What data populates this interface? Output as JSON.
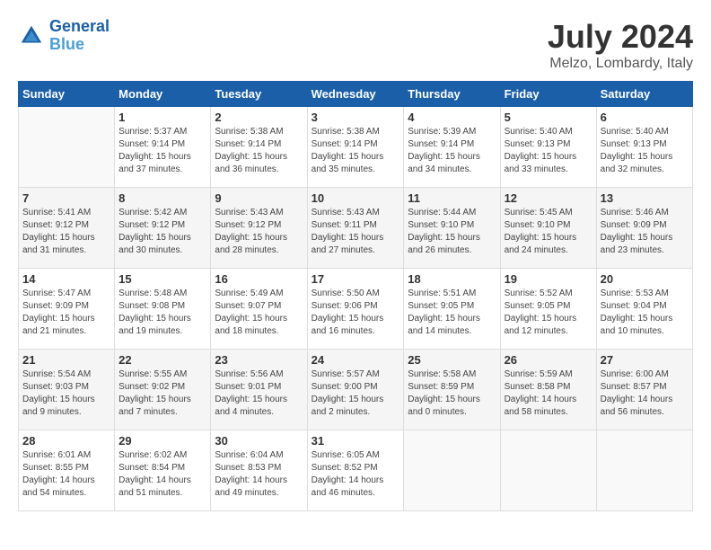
{
  "header": {
    "logo_line1": "General",
    "logo_line2": "Blue",
    "month_year": "July 2024",
    "location": "Melzo, Lombardy, Italy"
  },
  "weekdays": [
    "Sunday",
    "Monday",
    "Tuesday",
    "Wednesday",
    "Thursday",
    "Friday",
    "Saturday"
  ],
  "weeks": [
    [
      {
        "day": "",
        "sunrise": "",
        "sunset": "",
        "daylight": ""
      },
      {
        "day": "1",
        "sunrise": "Sunrise: 5:37 AM",
        "sunset": "Sunset: 9:14 PM",
        "daylight": "Daylight: 15 hours and 37 minutes."
      },
      {
        "day": "2",
        "sunrise": "Sunrise: 5:38 AM",
        "sunset": "Sunset: 9:14 PM",
        "daylight": "Daylight: 15 hours and 36 minutes."
      },
      {
        "day": "3",
        "sunrise": "Sunrise: 5:38 AM",
        "sunset": "Sunset: 9:14 PM",
        "daylight": "Daylight: 15 hours and 35 minutes."
      },
      {
        "day": "4",
        "sunrise": "Sunrise: 5:39 AM",
        "sunset": "Sunset: 9:14 PM",
        "daylight": "Daylight: 15 hours and 34 minutes."
      },
      {
        "day": "5",
        "sunrise": "Sunrise: 5:40 AM",
        "sunset": "Sunset: 9:13 PM",
        "daylight": "Daylight: 15 hours and 33 minutes."
      },
      {
        "day": "6",
        "sunrise": "Sunrise: 5:40 AM",
        "sunset": "Sunset: 9:13 PM",
        "daylight": "Daylight: 15 hours and 32 minutes."
      }
    ],
    [
      {
        "day": "7",
        "sunrise": "Sunrise: 5:41 AM",
        "sunset": "Sunset: 9:12 PM",
        "daylight": "Daylight: 15 hours and 31 minutes."
      },
      {
        "day": "8",
        "sunrise": "Sunrise: 5:42 AM",
        "sunset": "Sunset: 9:12 PM",
        "daylight": "Daylight: 15 hours and 30 minutes."
      },
      {
        "day": "9",
        "sunrise": "Sunrise: 5:43 AM",
        "sunset": "Sunset: 9:12 PM",
        "daylight": "Daylight: 15 hours and 28 minutes."
      },
      {
        "day": "10",
        "sunrise": "Sunrise: 5:43 AM",
        "sunset": "Sunset: 9:11 PM",
        "daylight": "Daylight: 15 hours and 27 minutes."
      },
      {
        "day": "11",
        "sunrise": "Sunrise: 5:44 AM",
        "sunset": "Sunset: 9:10 PM",
        "daylight": "Daylight: 15 hours and 26 minutes."
      },
      {
        "day": "12",
        "sunrise": "Sunrise: 5:45 AM",
        "sunset": "Sunset: 9:10 PM",
        "daylight": "Daylight: 15 hours and 24 minutes."
      },
      {
        "day": "13",
        "sunrise": "Sunrise: 5:46 AM",
        "sunset": "Sunset: 9:09 PM",
        "daylight": "Daylight: 15 hours and 23 minutes."
      }
    ],
    [
      {
        "day": "14",
        "sunrise": "Sunrise: 5:47 AM",
        "sunset": "Sunset: 9:09 PM",
        "daylight": "Daylight: 15 hours and 21 minutes."
      },
      {
        "day": "15",
        "sunrise": "Sunrise: 5:48 AM",
        "sunset": "Sunset: 9:08 PM",
        "daylight": "Daylight: 15 hours and 19 minutes."
      },
      {
        "day": "16",
        "sunrise": "Sunrise: 5:49 AM",
        "sunset": "Sunset: 9:07 PM",
        "daylight": "Daylight: 15 hours and 18 minutes."
      },
      {
        "day": "17",
        "sunrise": "Sunrise: 5:50 AM",
        "sunset": "Sunset: 9:06 PM",
        "daylight": "Daylight: 15 hours and 16 minutes."
      },
      {
        "day": "18",
        "sunrise": "Sunrise: 5:51 AM",
        "sunset": "Sunset: 9:05 PM",
        "daylight": "Daylight: 15 hours and 14 minutes."
      },
      {
        "day": "19",
        "sunrise": "Sunrise: 5:52 AM",
        "sunset": "Sunset: 9:05 PM",
        "daylight": "Daylight: 15 hours and 12 minutes."
      },
      {
        "day": "20",
        "sunrise": "Sunrise: 5:53 AM",
        "sunset": "Sunset: 9:04 PM",
        "daylight": "Daylight: 15 hours and 10 minutes."
      }
    ],
    [
      {
        "day": "21",
        "sunrise": "Sunrise: 5:54 AM",
        "sunset": "Sunset: 9:03 PM",
        "daylight": "Daylight: 15 hours and 9 minutes."
      },
      {
        "day": "22",
        "sunrise": "Sunrise: 5:55 AM",
        "sunset": "Sunset: 9:02 PM",
        "daylight": "Daylight: 15 hours and 7 minutes."
      },
      {
        "day": "23",
        "sunrise": "Sunrise: 5:56 AM",
        "sunset": "Sunset: 9:01 PM",
        "daylight": "Daylight: 15 hours and 4 minutes."
      },
      {
        "day": "24",
        "sunrise": "Sunrise: 5:57 AM",
        "sunset": "Sunset: 9:00 PM",
        "daylight": "Daylight: 15 hours and 2 minutes."
      },
      {
        "day": "25",
        "sunrise": "Sunrise: 5:58 AM",
        "sunset": "Sunset: 8:59 PM",
        "daylight": "Daylight: 15 hours and 0 minutes."
      },
      {
        "day": "26",
        "sunrise": "Sunrise: 5:59 AM",
        "sunset": "Sunset: 8:58 PM",
        "daylight": "Daylight: 14 hours and 58 minutes."
      },
      {
        "day": "27",
        "sunrise": "Sunrise: 6:00 AM",
        "sunset": "Sunset: 8:57 PM",
        "daylight": "Daylight: 14 hours and 56 minutes."
      }
    ],
    [
      {
        "day": "28",
        "sunrise": "Sunrise: 6:01 AM",
        "sunset": "Sunset: 8:55 PM",
        "daylight": "Daylight: 14 hours and 54 minutes."
      },
      {
        "day": "29",
        "sunrise": "Sunrise: 6:02 AM",
        "sunset": "Sunset: 8:54 PM",
        "daylight": "Daylight: 14 hours and 51 minutes."
      },
      {
        "day": "30",
        "sunrise": "Sunrise: 6:04 AM",
        "sunset": "Sunset: 8:53 PM",
        "daylight": "Daylight: 14 hours and 49 minutes."
      },
      {
        "day": "31",
        "sunrise": "Sunrise: 6:05 AM",
        "sunset": "Sunset: 8:52 PM",
        "daylight": "Daylight: 14 hours and 46 minutes."
      },
      {
        "day": "",
        "sunrise": "",
        "sunset": "",
        "daylight": ""
      },
      {
        "day": "",
        "sunrise": "",
        "sunset": "",
        "daylight": ""
      },
      {
        "day": "",
        "sunrise": "",
        "sunset": "",
        "daylight": ""
      }
    ]
  ]
}
